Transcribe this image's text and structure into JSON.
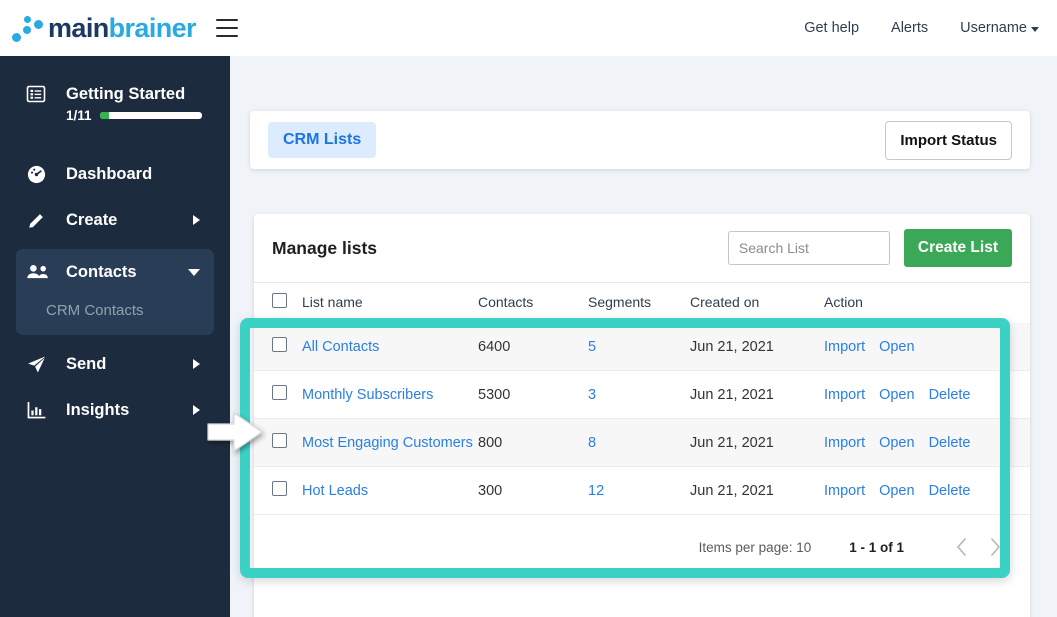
{
  "brand": {
    "name_a": "main",
    "name_b": "brainer"
  },
  "topnav": {
    "get_help": "Get help",
    "alerts": "Alerts",
    "username": "Username"
  },
  "sidebar": {
    "getting_started": {
      "label": "Getting Started",
      "count": "1/11",
      "progress_percent": 9
    },
    "items": [
      {
        "label": "Dashboard",
        "icon": "gauge-icon",
        "has_arrow": false
      },
      {
        "label": "Create",
        "icon": "pencil-icon",
        "has_arrow": true
      },
      {
        "label": "Contacts",
        "icon": "people-icon",
        "has_arrow": true,
        "expanded": true,
        "children": [
          {
            "label": "CRM Contacts"
          }
        ]
      },
      {
        "label": "Send",
        "icon": "paper-plane-icon",
        "has_arrow": true
      },
      {
        "label": "Insights",
        "icon": "bar-chart-icon",
        "has_arrow": true
      }
    ]
  },
  "tabbar": {
    "tabs": [
      {
        "label": "CRM Lists",
        "active": true
      }
    ],
    "import_status_label": "Import Status"
  },
  "card": {
    "title": "Manage lists",
    "search": {
      "placeholder": "Search List",
      "value": ""
    },
    "create_button": "Create List",
    "columns": [
      "List name",
      "Contacts",
      "Segments",
      "Created on",
      "Action"
    ],
    "rows": [
      {
        "name": "All Contacts",
        "contacts": "6400",
        "segments": "5",
        "created_on": "Jun 21, 2021",
        "actions": [
          "Import",
          "Open"
        ]
      },
      {
        "name": "Monthly Subscribers",
        "contacts": "5300",
        "segments": "3",
        "created_on": "Jun 21, 2021",
        "actions": [
          "Import",
          "Open",
          "Delete"
        ]
      },
      {
        "name": "Most Engaging Customers",
        "contacts": "800",
        "segments": "8",
        "created_on": "Jun 21, 2021",
        "actions": [
          "Import",
          "Open",
          "Delete"
        ]
      },
      {
        "name": "Hot Leads",
        "contacts": "300",
        "segments": "12",
        "created_on": "Jun 21, 2021",
        "actions": [
          "Import",
          "Open",
          "Delete"
        ]
      }
    ],
    "pager": {
      "items_per_page": "Items per page: 10",
      "range": "1 - 1 of 1"
    }
  },
  "colors": {
    "sidebar_bg": "#1d2b3f",
    "sidebar_active": "#2a3d57",
    "accent_blue": "#29abe2",
    "link_blue": "#2a7fe0",
    "tab_bg": "#dcebfd",
    "create_green": "#3aa856",
    "progress_green": "#37b34a",
    "highlight_teal": "#3bd2c5",
    "content_bg": "#f0f4f8"
  }
}
